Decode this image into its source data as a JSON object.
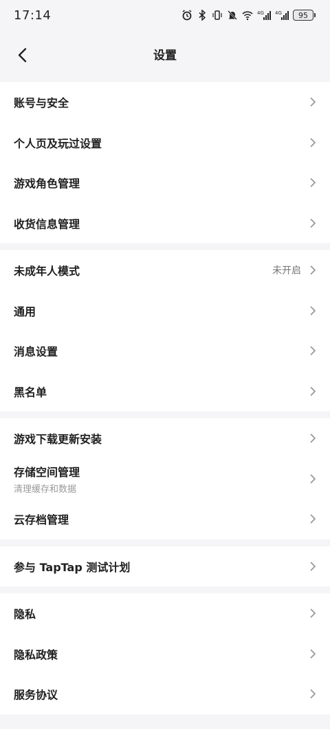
{
  "status_bar": {
    "time": "17:14",
    "battery": "95",
    "icons": [
      "alarm-icon",
      "bluetooth-icon",
      "vibrate-icon",
      "mute-icon",
      "wifi-icon",
      "signal-4g-icon",
      "signal-4g-icon"
    ]
  },
  "nav": {
    "title": "设置",
    "back_icon": "chevron-left-icon"
  },
  "groups": [
    {
      "items": [
        {
          "label": "账号与安全"
        },
        {
          "label": "个人页及玩过设置"
        },
        {
          "label": "游戏角色管理"
        },
        {
          "label": "收货信息管理"
        }
      ]
    },
    {
      "items": [
        {
          "label": "未成年人模式",
          "value": "未开启"
        },
        {
          "label": "通用"
        },
        {
          "label": "消息设置"
        },
        {
          "label": "黑名单"
        }
      ]
    },
    {
      "items": [
        {
          "label": "游戏下载更新安装"
        },
        {
          "label": "存储空间管理",
          "sub": "清理缓存和数据"
        },
        {
          "label": "云存档管理"
        }
      ]
    },
    {
      "items": [
        {
          "label": "参与 TapTap 测试计划"
        }
      ]
    },
    {
      "items": [
        {
          "label": "隐私"
        },
        {
          "label": "隐私政策"
        },
        {
          "label": "服务协议"
        }
      ]
    }
  ],
  "colors": {
    "background": "#f5f5f7",
    "row_background": "#ffffff",
    "text_primary": "#1f1f1f",
    "text_secondary": "#999999",
    "chevron": "#999999"
  }
}
